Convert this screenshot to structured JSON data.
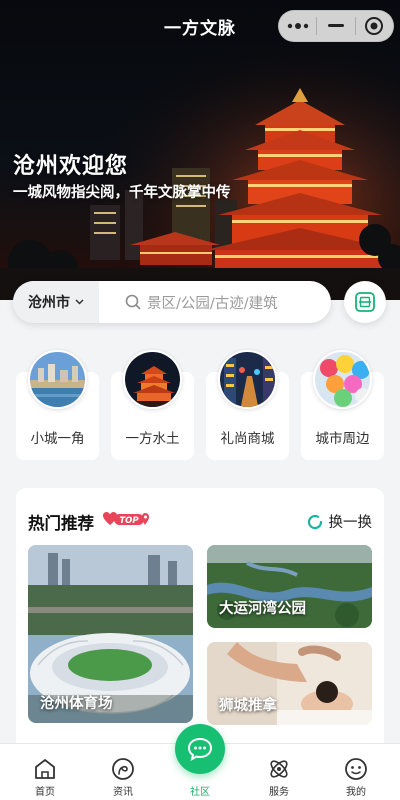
{
  "header": {
    "title": "一方文脉",
    "capsule": {
      "more_icon": "more-dots-icon",
      "minimize_icon": "minimize-icon",
      "close_icon": "target-circle-icon"
    }
  },
  "hero": {
    "headline": "沧州欢迎您",
    "subtitle": "一城风物指尖阅，千年文脉掌中传"
  },
  "search": {
    "city": "沧州市",
    "city_icon": "chevron-down-icon",
    "placeholder": "景区/公园/古迹/建筑",
    "search_icon": "search-icon",
    "scan_icon": "scan-code-icon"
  },
  "categories": [
    {
      "label": "小城一角"
    },
    {
      "label": "一方水土"
    },
    {
      "label": "礼尚商城"
    },
    {
      "label": "城市周边"
    }
  ],
  "hot": {
    "title": "热门推荐",
    "badge": "TOP",
    "swap_label": "换一换",
    "items": [
      {
        "label": "沧州体育场"
      },
      {
        "label": "大运河湾公园"
      },
      {
        "label": "狮城推拿"
      }
    ]
  },
  "tabbar": {
    "active": "社区",
    "items": [
      {
        "label": "首页",
        "icon": "home-icon"
      },
      {
        "label": "资讯",
        "icon": "news-icon"
      },
      {
        "label": "社区",
        "icon": "chat-bubble-icon"
      },
      {
        "label": "服务",
        "icon": "service-atom-icon"
      },
      {
        "label": "我的",
        "icon": "profile-face-icon"
      }
    ]
  },
  "colors": {
    "accent": "#17bf72",
    "badge": "#e8455a",
    "swap_ring": "#19b4a0"
  }
}
